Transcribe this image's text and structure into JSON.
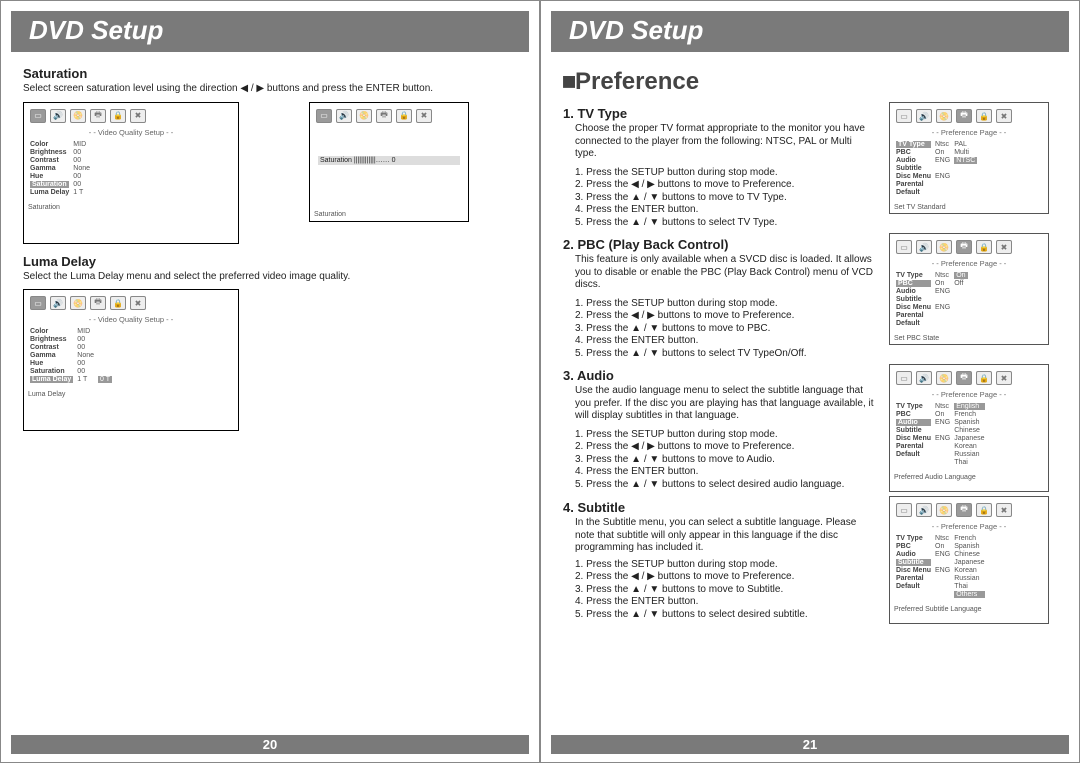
{
  "left": {
    "header": "DVD Setup",
    "saturation": {
      "title": "Saturation",
      "desc": "Select screen saturation level using the direction ◀ / ▶ buttons and press the ENTER button."
    },
    "luma": {
      "title": "Luma Delay",
      "desc": "Select the Luma Delay menu and select the preferred video image quality."
    },
    "osd_header": "- - Video Quality Setup - -",
    "osd_labels": [
      "Color",
      "Brightness",
      "Contrast",
      "Gamma",
      "Hue",
      "Saturation",
      "Luma Delay"
    ],
    "osd_vals1": [
      "MID",
      "00",
      "00",
      "None",
      "00",
      "00",
      "1 T"
    ],
    "osd_vals2": [
      "MID",
      "00",
      "00",
      "None",
      "00",
      "00",
      "1 T"
    ],
    "osd_vals2b": [
      "",
      "",
      "",
      "",
      "",
      "",
      "0 T"
    ],
    "osd_footer1": "Saturation",
    "osd_footer2": "Luma Delay",
    "sat_overlay": "Saturation ||||||||||||…… 0",
    "sat_overlay_footer": "Saturation",
    "pagenum": "20"
  },
  "right": {
    "header": "DVD Setup",
    "main_title": "Preference",
    "tv": {
      "title": "1. TV Type",
      "desc": "Choose the proper TV format appropriate to the monitor you have connected to the player from the following: NTSC, PAL or Multi type.",
      "steps": "1. Press the SETUP button during stop mode.\n2. Press the ◀ / ▶ buttons to move to Preference.\n3. Press the ▲ / ▼ buttons to move to TV Type.\n4. Press the ENTER button.\n5. Press the ▲ / ▼ buttons to select TV Type."
    },
    "pbc": {
      "title": "2. PBC (Play Back Control)",
      "desc": "This feature is only available when a SVCD disc is loaded. It allows you to disable or enable the PBC (Play Back Control) menu of VCD discs.",
      "steps": "1. Press the SETUP button during stop mode.\n2. Press the ◀ / ▶ buttons to move to Preference.\n3. Press the ▲ / ▼ buttons to move to PBC.\n4. Press the ENTER button.\n5. Press the ▲ / ▼ buttons to select TV TypeOn/Off."
    },
    "audio": {
      "title": "3. Audio",
      "desc": "Use the audio language menu to select the subtitle language that you prefer. If the disc you are playing has that language available, it will display subtitles in that language.",
      "steps": "1. Press the SETUP button during stop mode.\n2. Press the ◀ / ▶ buttons to move to Preference.\n3. Press the ▲ / ▼ buttons to move to Audio.\n4. Press the ENTER button.\n5. Press the ▲ / ▼ buttons to select desired audio language."
    },
    "subtitle": {
      "title": "4. Subtitle",
      "desc": "In the Subtitle menu, you can select a subtitle language. Please note that subtitle will only appear in this language if the disc programming has included it.",
      "steps": "1. Press the SETUP button during stop mode.\n2. Press the ◀ / ▶ buttons to move to Preference.\n3. Press the ▲ / ▼ buttons to move to Subtitle.\n4. Press the ENTER button.\n5. Press the ▲ / ▼ buttons to select desired subtitle."
    },
    "osd_pref_header": "- - Preference Page - -",
    "pref_labels": [
      "TV Type",
      "PBC",
      "Audio",
      "Subtitle",
      "Disc Menu",
      "Parental",
      "Default"
    ],
    "tv_vals": [
      "Ntsc",
      "On",
      "ENG",
      "",
      "ENG",
      "",
      ""
    ],
    "tv_opts": [
      "PAL",
      "Multi",
      "NTSC"
    ],
    "tv_footer": "Set TV Standard",
    "pbc_vals": [
      "Ntsc",
      "On",
      "ENG",
      "",
      "ENG",
      "",
      ""
    ],
    "pbc_opts": [
      "On",
      "Off"
    ],
    "pbc_footer": "Set PBC State",
    "audio_vals": [
      "Ntsc",
      "On",
      "ENG",
      "",
      "ENG",
      "",
      ""
    ],
    "audio_opts": [
      "English",
      "French",
      "Spanish",
      "Chinese",
      "Japanese",
      "Korean",
      "Russian",
      "Thai"
    ],
    "audio_footer": "Preferred Audio Language",
    "sub_vals": [
      "Ntsc",
      "On",
      "ENG",
      "",
      "ENG",
      "",
      ""
    ],
    "sub_opts": [
      "French",
      "Spanish",
      "Chinese",
      "Japanese",
      "Korean",
      "Russian",
      "Thai",
      "Others"
    ],
    "sub_footer": "Preferred Subtitle Language",
    "pagenum": "21"
  }
}
